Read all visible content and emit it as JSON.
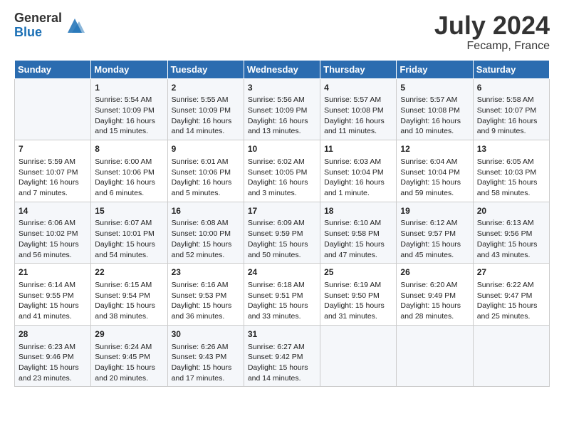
{
  "header": {
    "logo_general": "General",
    "logo_blue": "Blue",
    "title": "July 2024",
    "location": "Fecamp, France"
  },
  "columns": [
    "Sunday",
    "Monday",
    "Tuesday",
    "Wednesday",
    "Thursday",
    "Friday",
    "Saturday"
  ],
  "weeks": [
    [
      {
        "day": "",
        "content": ""
      },
      {
        "day": "1",
        "content": "Sunrise: 5:54 AM\nSunset: 10:09 PM\nDaylight: 16 hours\nand 15 minutes."
      },
      {
        "day": "2",
        "content": "Sunrise: 5:55 AM\nSunset: 10:09 PM\nDaylight: 16 hours\nand 14 minutes."
      },
      {
        "day": "3",
        "content": "Sunrise: 5:56 AM\nSunset: 10:09 PM\nDaylight: 16 hours\nand 13 minutes."
      },
      {
        "day": "4",
        "content": "Sunrise: 5:57 AM\nSunset: 10:08 PM\nDaylight: 16 hours\nand 11 minutes."
      },
      {
        "day": "5",
        "content": "Sunrise: 5:57 AM\nSunset: 10:08 PM\nDaylight: 16 hours\nand 10 minutes."
      },
      {
        "day": "6",
        "content": "Sunrise: 5:58 AM\nSunset: 10:07 PM\nDaylight: 16 hours\nand 9 minutes."
      }
    ],
    [
      {
        "day": "7",
        "content": "Sunrise: 5:59 AM\nSunset: 10:07 PM\nDaylight: 16 hours\nand 7 minutes."
      },
      {
        "day": "8",
        "content": "Sunrise: 6:00 AM\nSunset: 10:06 PM\nDaylight: 16 hours\nand 6 minutes."
      },
      {
        "day": "9",
        "content": "Sunrise: 6:01 AM\nSunset: 10:06 PM\nDaylight: 16 hours\nand 5 minutes."
      },
      {
        "day": "10",
        "content": "Sunrise: 6:02 AM\nSunset: 10:05 PM\nDaylight: 16 hours\nand 3 minutes."
      },
      {
        "day": "11",
        "content": "Sunrise: 6:03 AM\nSunset: 10:04 PM\nDaylight: 16 hours\nand 1 minute."
      },
      {
        "day": "12",
        "content": "Sunrise: 6:04 AM\nSunset: 10:04 PM\nDaylight: 15 hours\nand 59 minutes."
      },
      {
        "day": "13",
        "content": "Sunrise: 6:05 AM\nSunset: 10:03 PM\nDaylight: 15 hours\nand 58 minutes."
      }
    ],
    [
      {
        "day": "14",
        "content": "Sunrise: 6:06 AM\nSunset: 10:02 PM\nDaylight: 15 hours\nand 56 minutes."
      },
      {
        "day": "15",
        "content": "Sunrise: 6:07 AM\nSunset: 10:01 PM\nDaylight: 15 hours\nand 54 minutes."
      },
      {
        "day": "16",
        "content": "Sunrise: 6:08 AM\nSunset: 10:00 PM\nDaylight: 15 hours\nand 52 minutes."
      },
      {
        "day": "17",
        "content": "Sunrise: 6:09 AM\nSunset: 9:59 PM\nDaylight: 15 hours\nand 50 minutes."
      },
      {
        "day": "18",
        "content": "Sunrise: 6:10 AM\nSunset: 9:58 PM\nDaylight: 15 hours\nand 47 minutes."
      },
      {
        "day": "19",
        "content": "Sunrise: 6:12 AM\nSunset: 9:57 PM\nDaylight: 15 hours\nand 45 minutes."
      },
      {
        "day": "20",
        "content": "Sunrise: 6:13 AM\nSunset: 9:56 PM\nDaylight: 15 hours\nand 43 minutes."
      }
    ],
    [
      {
        "day": "21",
        "content": "Sunrise: 6:14 AM\nSunset: 9:55 PM\nDaylight: 15 hours\nand 41 minutes."
      },
      {
        "day": "22",
        "content": "Sunrise: 6:15 AM\nSunset: 9:54 PM\nDaylight: 15 hours\nand 38 minutes."
      },
      {
        "day": "23",
        "content": "Sunrise: 6:16 AM\nSunset: 9:53 PM\nDaylight: 15 hours\nand 36 minutes."
      },
      {
        "day": "24",
        "content": "Sunrise: 6:18 AM\nSunset: 9:51 PM\nDaylight: 15 hours\nand 33 minutes."
      },
      {
        "day": "25",
        "content": "Sunrise: 6:19 AM\nSunset: 9:50 PM\nDaylight: 15 hours\nand 31 minutes."
      },
      {
        "day": "26",
        "content": "Sunrise: 6:20 AM\nSunset: 9:49 PM\nDaylight: 15 hours\nand 28 minutes."
      },
      {
        "day": "27",
        "content": "Sunrise: 6:22 AM\nSunset: 9:47 PM\nDaylight: 15 hours\nand 25 minutes."
      }
    ],
    [
      {
        "day": "28",
        "content": "Sunrise: 6:23 AM\nSunset: 9:46 PM\nDaylight: 15 hours\nand 23 minutes."
      },
      {
        "day": "29",
        "content": "Sunrise: 6:24 AM\nSunset: 9:45 PM\nDaylight: 15 hours\nand 20 minutes."
      },
      {
        "day": "30",
        "content": "Sunrise: 6:26 AM\nSunset: 9:43 PM\nDaylight: 15 hours\nand 17 minutes."
      },
      {
        "day": "31",
        "content": "Sunrise: 6:27 AM\nSunset: 9:42 PM\nDaylight: 15 hours\nand 14 minutes."
      },
      {
        "day": "",
        "content": ""
      },
      {
        "day": "",
        "content": ""
      },
      {
        "day": "",
        "content": ""
      }
    ]
  ]
}
